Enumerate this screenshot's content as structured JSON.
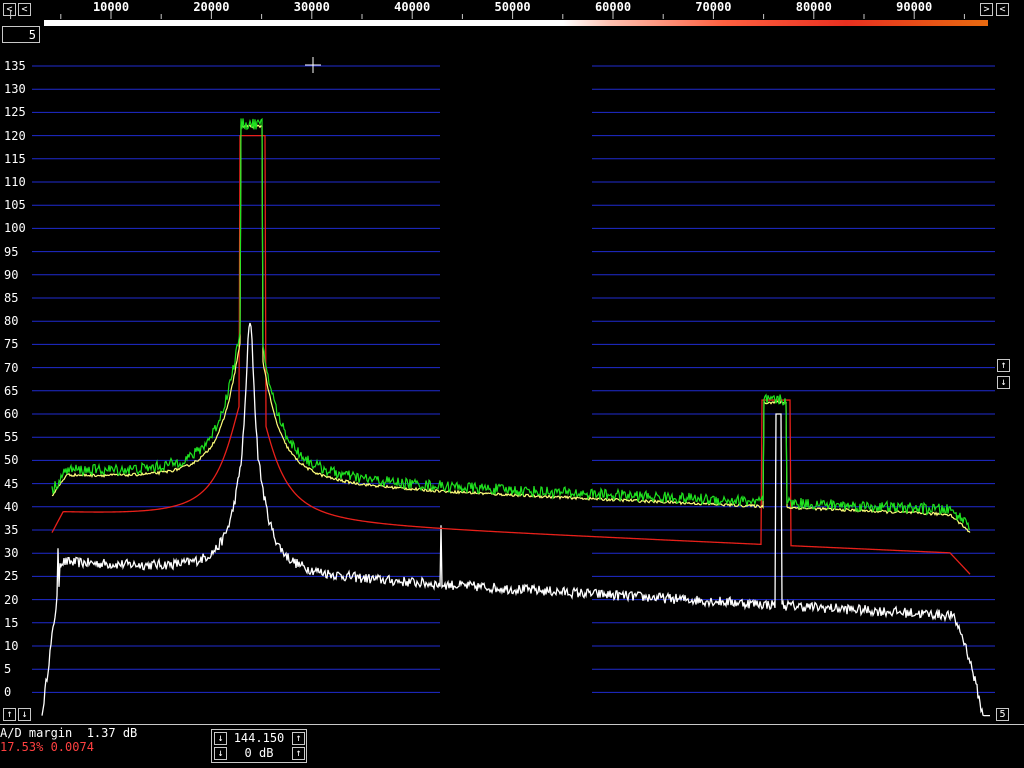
{
  "colors": {
    "background": "#000000",
    "grid": "#1f2bd0",
    "trace_white": "#ffffff",
    "trace_green": "#1fe21f",
    "trace_yellow": "#ffff7a",
    "trace_red": "#e8201a",
    "status_red": "#ff4040"
  },
  "frequency_axis": {
    "labels": [
      "10000",
      "20000",
      "30000",
      "40000",
      "50000",
      "60000",
      "70000",
      "80000",
      "90000"
    ]
  },
  "top_buttons": {
    "left_a": "<",
    "left_b": "<",
    "right_a": ">",
    "right_b": "<"
  },
  "y_axis": {
    "labels": [
      "135",
      "130",
      "125",
      "120",
      "115",
      "110",
      "105",
      "100",
      "95",
      "90",
      "85",
      "80",
      "75",
      "70",
      "65",
      "60",
      "55",
      "50",
      "45",
      "40",
      "35",
      "30",
      "25",
      "20",
      "15",
      "10",
      "5",
      "0"
    ]
  },
  "averages_box": "5",
  "side_buttons": {
    "up": "↑",
    "down": "↓"
  },
  "bottom_left_buttons": {
    "up": "↑",
    "down": "↓"
  },
  "bottom_right_box": "5",
  "status": {
    "ad_margin": "A/D margin  1.37 dB",
    "percent_line": "17.53% 0.0074"
  },
  "center_panel": {
    "frequency": "144.150",
    "gain": "0 dB"
  }
}
